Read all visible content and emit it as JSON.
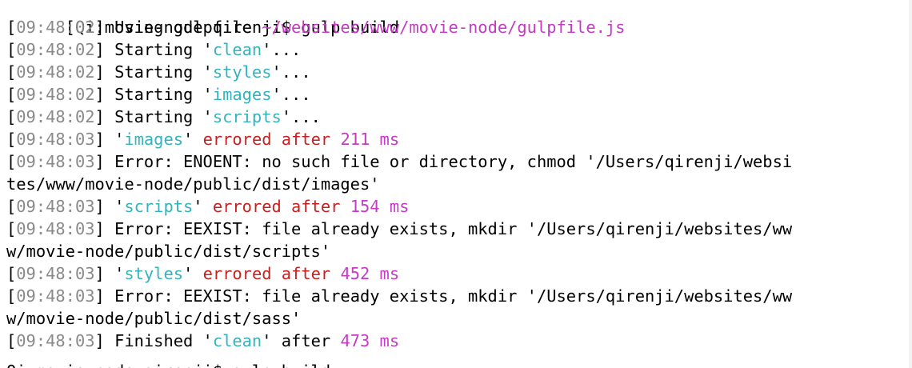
{
  "terminal": {
    "partial_top_text": "[Qi:movie-node qirenji$ gulp build",
    "prompt": "Qi:movie-node qirenji$ gulp build",
    "partial_bottom_text": "Qi:movie-node qirenji$ gulp build",
    "lines": [
      {
        "ts": "09:48:02",
        "parts": [
          {
            "t": "Using gulpfile ",
            "c": ""
          },
          {
            "t": "~/websites/www/movie-node/gulpfile.js",
            "c": "mg"
          }
        ]
      },
      {
        "ts": "09:48:02",
        "parts": [
          {
            "t": "Starting '",
            "c": ""
          },
          {
            "t": "clean",
            "c": "cy"
          },
          {
            "t": "'...",
            "c": ""
          }
        ]
      },
      {
        "ts": "09:48:02",
        "parts": [
          {
            "t": "Starting '",
            "c": ""
          },
          {
            "t": "styles",
            "c": "cy"
          },
          {
            "t": "'...",
            "c": ""
          }
        ]
      },
      {
        "ts": "09:48:02",
        "parts": [
          {
            "t": "Starting '",
            "c": ""
          },
          {
            "t": "images",
            "c": "cy"
          },
          {
            "t": "'...",
            "c": ""
          }
        ]
      },
      {
        "ts": "09:48:02",
        "parts": [
          {
            "t": "Starting '",
            "c": ""
          },
          {
            "t": "scripts",
            "c": "cy"
          },
          {
            "t": "'...",
            "c": ""
          }
        ]
      },
      {
        "ts": "09:48:03",
        "parts": [
          {
            "t": "'",
            "c": ""
          },
          {
            "t": "images",
            "c": "cy"
          },
          {
            "t": "' ",
            "c": ""
          },
          {
            "t": "errored after",
            "c": "rd"
          },
          {
            "t": " ",
            "c": ""
          },
          {
            "t": "211 ms",
            "c": "mg"
          }
        ]
      },
      {
        "ts": "09:48:03",
        "parts": [
          {
            "t": "Error: ENOENT: no such file or directory, chmod '/Users/qirenji/websi",
            "c": ""
          }
        ]
      },
      {
        "ts": "",
        "parts": [
          {
            "t": "tes/www/movie-node/public/dist/images'",
            "c": ""
          }
        ]
      },
      {
        "ts": "09:48:03",
        "parts": [
          {
            "t": "'",
            "c": ""
          },
          {
            "t": "scripts",
            "c": "cy"
          },
          {
            "t": "' ",
            "c": ""
          },
          {
            "t": "errored after",
            "c": "rd"
          },
          {
            "t": " ",
            "c": ""
          },
          {
            "t": "154 ms",
            "c": "mg"
          }
        ]
      },
      {
        "ts": "09:48:03",
        "parts": [
          {
            "t": "Error: EEXIST: file already exists, mkdir '/Users/qirenji/websites/ww",
            "c": ""
          }
        ]
      },
      {
        "ts": "",
        "parts": [
          {
            "t": "w/movie-node/public/dist/scripts'",
            "c": ""
          }
        ]
      },
      {
        "ts": "09:48:03",
        "parts": [
          {
            "t": "'",
            "c": ""
          },
          {
            "t": "styles",
            "c": "cy"
          },
          {
            "t": "' ",
            "c": ""
          },
          {
            "t": "errored after",
            "c": "rd"
          },
          {
            "t": " ",
            "c": ""
          },
          {
            "t": "452 ms",
            "c": "mg"
          }
        ]
      },
      {
        "ts": "09:48:03",
        "parts": [
          {
            "t": "Error: EEXIST: file already exists, mkdir '/Users/qirenji/websites/ww",
            "c": ""
          }
        ]
      },
      {
        "ts": "",
        "parts": [
          {
            "t": "w/movie-node/public/dist/sass'",
            "c": ""
          }
        ]
      },
      {
        "ts": "09:48:03",
        "parts": [
          {
            "t": "Finished '",
            "c": ""
          },
          {
            "t": "clean",
            "c": "cy"
          },
          {
            "t": "' after ",
            "c": ""
          },
          {
            "t": "473 ms",
            "c": "mg"
          }
        ]
      }
    ]
  },
  "colors": {
    "background": "#ffffff",
    "text": "#000000",
    "timestamp": "#8a8a8a",
    "task_name": "#33b3be",
    "path_and_duration": "#c43bc4",
    "error": "#c62020"
  }
}
